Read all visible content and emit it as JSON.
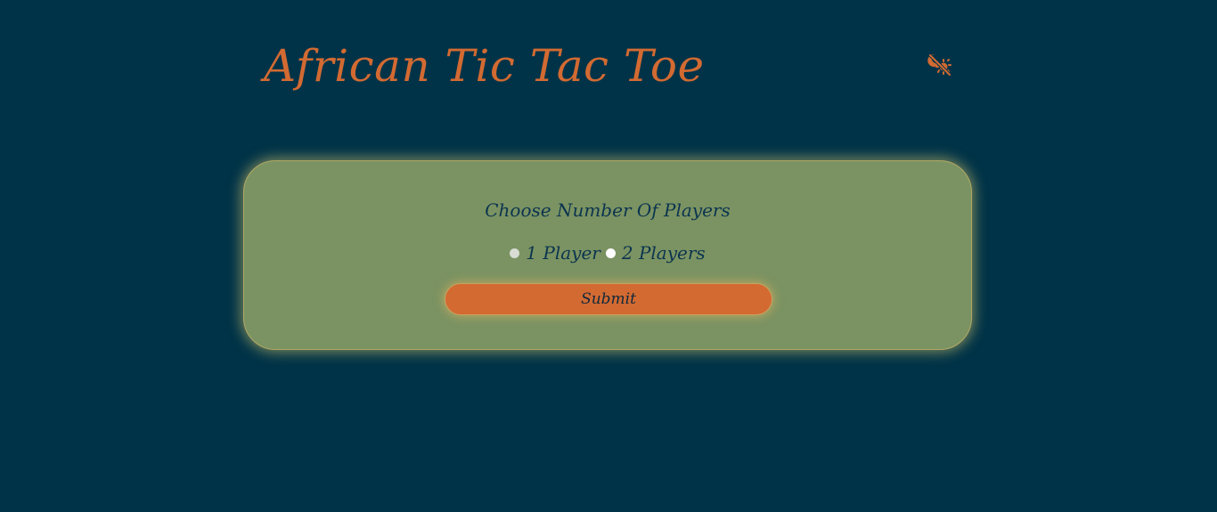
{
  "header": {
    "title": "African Tic Tac Toe",
    "theme_toggle_icon": "sun-moon-toggle-icon"
  },
  "setup_card": {
    "prompt": "Choose Number Of Players",
    "options": [
      {
        "label": "1 Player",
        "selected": false
      },
      {
        "label": "2 Players",
        "selected": false
      }
    ],
    "submit_label": "Submit"
  },
  "colors": {
    "background": "#003348",
    "accent": "#d26a32",
    "card": "#7b9362",
    "text_dark": "#0b3450"
  }
}
